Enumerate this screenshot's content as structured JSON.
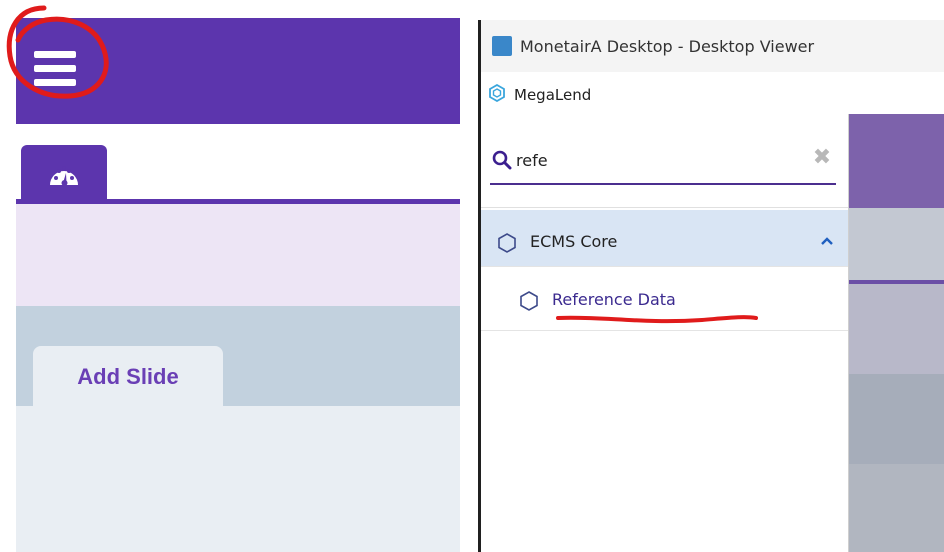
{
  "left_panel": {
    "menu_icon": "hamburger-menu-icon",
    "dashboard_tab_icon": "speedometer-icon",
    "add_slide_tab": "Add Slide"
  },
  "right_panel": {
    "window_title": "MonetairA Desktop - Desktop Viewer",
    "app_name": "MegaLend",
    "search": {
      "value": "refe",
      "icon": "search-icon",
      "clear_icon": "clear-icon"
    },
    "tree": [
      {
        "label": "ECMS Core",
        "icon": "hexagon-icon",
        "expanded": true
      },
      {
        "label": "Reference Data",
        "icon": "hexagon-icon",
        "link": true
      }
    ]
  },
  "colors": {
    "brand_purple": "#5c35ad",
    "lavender": "#ede5f5",
    "steel": "#c2d1de",
    "selected_row": "#d9e5f4",
    "annotation_red": "#e01b1b"
  }
}
